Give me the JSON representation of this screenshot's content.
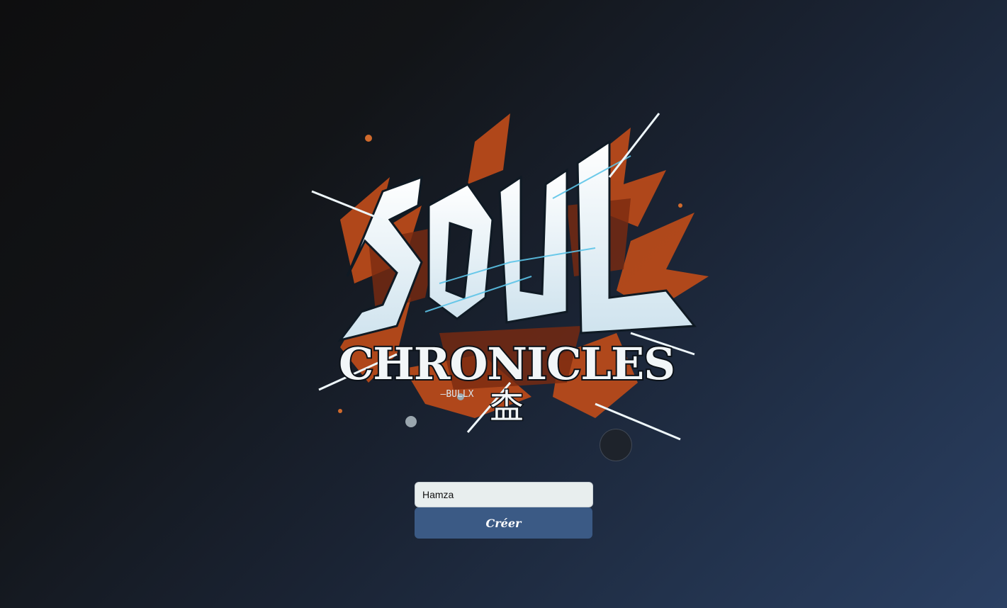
{
  "logo": {
    "title_word": "SOUL",
    "subtitle_word": "CHRONICLES",
    "tagline": "—BULLX",
    "glyph": "㭗"
  },
  "form": {
    "name_value": "Hamza",
    "name_placeholder": "",
    "create_label": "Créer"
  },
  "colors": {
    "accent": "#3b5a85",
    "logo_orange": "#c4551f",
    "logo_ice": "#e6f2f8",
    "logo_cyan": "#4fb3d9"
  }
}
